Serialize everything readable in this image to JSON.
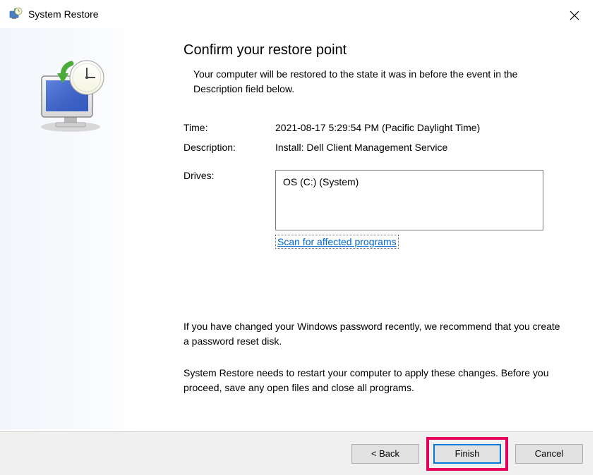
{
  "window": {
    "title": "System Restore"
  },
  "main": {
    "heading": "Confirm your restore point",
    "subheading": "Your computer will be restored to the state it was in before the event in the Description field below.",
    "time_label": "Time:",
    "time_value": "2021-08-17 5:29:54 PM (Pacific Daylight Time)",
    "description_label": "Description:",
    "description_value": "Install: Dell Client Management Service",
    "drives_label": "Drives:",
    "drives_value": "OS (C:) (System)",
    "scan_link": "Scan for affected programs",
    "warning1": "If you have changed your Windows password recently, we recommend that you create a password reset disk.",
    "warning2": "System Restore needs to restart your computer to apply these changes. Before you proceed, save any open files and close all programs."
  },
  "footer": {
    "back": "< Back",
    "finish": "Finish",
    "cancel": "Cancel"
  }
}
